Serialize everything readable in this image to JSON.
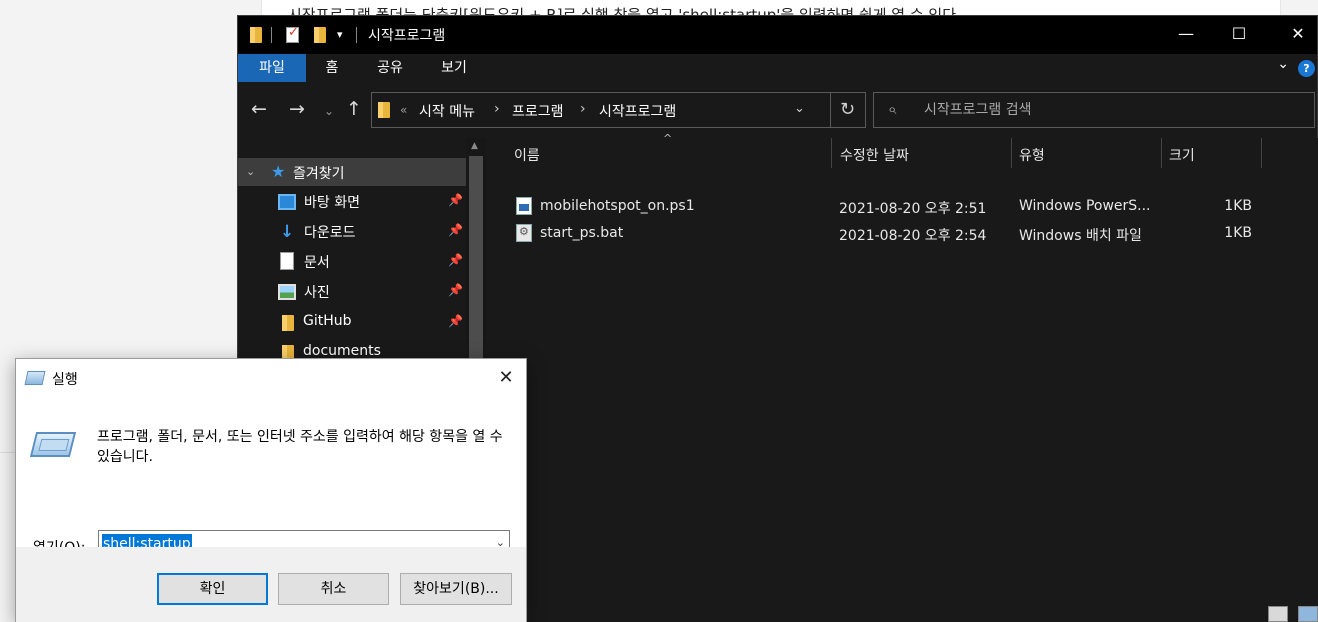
{
  "background": {
    "article_text": "시작프로그램 폴더는 단축키[윈도우키 + R]로 실행 창을 열고 'shell:startup'을 입력하면 쉽게 열 수 있다."
  },
  "explorer": {
    "title": "시작프로그램",
    "qa_arrow": "▾",
    "window_buttons": {
      "minimize": "—",
      "maximize": "☐",
      "close": "✕"
    },
    "ribbon_tabs": [
      "파일",
      "홈",
      "공유",
      "보기"
    ],
    "ribbon_collapse": "⌄",
    "help": "?",
    "nav": {
      "back": "←",
      "forward": "→",
      "recent": "⌄",
      "up": "↑"
    },
    "address": {
      "overflow": "«",
      "breadcrumb": [
        "시작 메뉴",
        "프로그램",
        "시작프로그램"
      ],
      "separator": "›",
      "dropdown": "⌄",
      "refresh": "↻"
    },
    "search": {
      "placeholder": "시작프로그램 검색",
      "icon": "⌕"
    },
    "nav_pane": {
      "quick_access_label": "즐겨찾기",
      "quick_access_chevron": "⌄",
      "star_icon": "★",
      "pin_icon": "📌",
      "scroll_up": "▲",
      "items": [
        {
          "label": "바탕 화면",
          "icon": "desktop-icon",
          "pinned": true
        },
        {
          "label": "다운로드",
          "icon": "download-icon",
          "pinned": true
        },
        {
          "label": "문서",
          "icon": "document-icon",
          "pinned": true
        },
        {
          "label": "사진",
          "icon": "picture-icon",
          "pinned": true
        },
        {
          "label": "GitHub",
          "icon": "folder-icon",
          "pinned": true
        },
        {
          "label": "documents",
          "icon": "folder-icon",
          "pinned": false
        }
      ]
    },
    "file_list": {
      "sort_indicator": "^",
      "columns": [
        "이름",
        "수정한 날짜",
        "유형",
        "크기"
      ],
      "rows": [
        {
          "name": "mobilehotspot_on.ps1",
          "modified": "2021-08-20 오후 2:51",
          "type": "Windows PowerS...",
          "size": "1KB",
          "icon": "powershell-file-icon"
        },
        {
          "name": "start_ps.bat",
          "modified": "2021-08-20 오후 2:54",
          "type": "Windows 배치 파일",
          "size": "1KB",
          "icon": "batch-file-icon"
        }
      ]
    }
  },
  "run_dialog": {
    "title": "실행",
    "close": "✕",
    "description": "프로그램, 폴더, 문서, 또는 인터넷 주소를 입력하여 해당 항목을 열 수 있습니다.",
    "open_label": "열기(",
    "open_mnemonic": "O",
    "open_label_end": "):",
    "input_value": "shell:startup",
    "dropdown": "⌄",
    "buttons": {
      "ok": "확인",
      "cancel": "취소",
      "browse": "찾아보기(B)..."
    }
  },
  "colors": {
    "explorer_bg": "#191919",
    "titlebar_bg": "#000000",
    "ribbon_active": "#1a67b5",
    "selection_blue": "#0078d7",
    "dialog_footer": "#f0f0f0"
  }
}
